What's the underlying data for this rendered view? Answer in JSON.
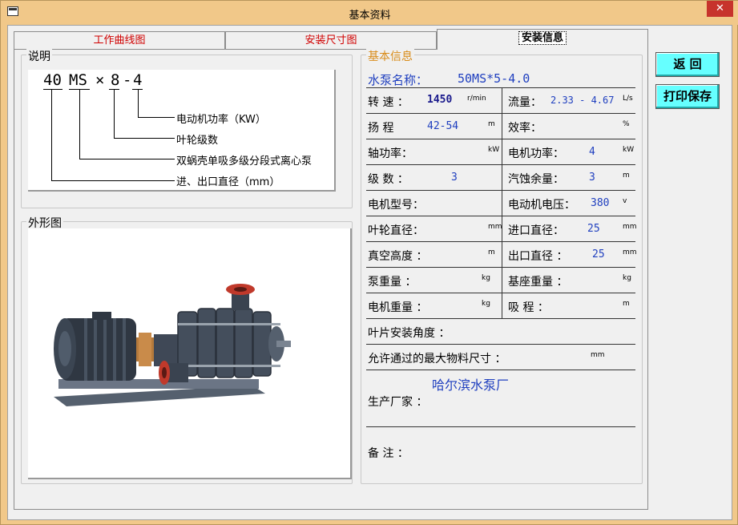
{
  "window": {
    "title": "基本资料",
    "close_label": "✕"
  },
  "tabs": [
    {
      "label": "工作曲线图"
    },
    {
      "label": "安装尺寸图"
    },
    {
      "label": "安装信息"
    }
  ],
  "buttons": {
    "back": "返  回",
    "print_save": "打印保存"
  },
  "explain": {
    "legend": "说明",
    "code_parts": [
      "40",
      "MS",
      "×",
      "8",
      "-",
      "4"
    ],
    "desc_power": "电动机功率（KW）",
    "desc_stages": "叶轮级数",
    "desc_type": "双蜗壳单吸多级分段式离心泵",
    "desc_diameter": "进、出口直径（mm）"
  },
  "appearance": {
    "legend": "外形图"
  },
  "info": {
    "legend": "基本信息",
    "pump_name_label": "水泵名称：",
    "pump_name_value": "50MS*5-4.0",
    "speed_label": "转 速 ：",
    "speed_value": "1450",
    "speed_unit": "r/min",
    "flow_label": "流量：",
    "flow_value": "2.33 - 4.67",
    "flow_unit": "L/s",
    "head_label": "扬 程",
    "head_value": "42-54",
    "head_unit": "m",
    "eff_label": "效率：",
    "eff_unit": "%",
    "shaft_power_label": "轴功率：",
    "shaft_power_unit": "kW",
    "motor_power_label": "电机功率：",
    "motor_power_value": "4",
    "motor_power_unit": "kW",
    "stages_label": "级 数 ：",
    "stages_value": "3",
    "npsh_label": "汽蚀余量：",
    "npsh_value": "3",
    "npsh_unit": "m",
    "motor_model_label": "电机型号：",
    "motor_voltage_label": "电动机电压：",
    "motor_voltage_value": "380",
    "motor_voltage_unit": "v",
    "impeller_dia_label": "叶轮直径：",
    "impeller_dia_unit": "mm",
    "inlet_dia_label": "进口直径：",
    "inlet_dia_value": "25",
    "inlet_dia_unit": "mm",
    "vacuum_label": "真空高度 ：",
    "vacuum_unit": "m",
    "outlet_dia_label": "出口直径 ：",
    "outlet_dia_value": "25",
    "outlet_dia_unit": "mm",
    "pump_weight_label": "泵重量 ：",
    "pump_weight_unit": "kg",
    "base_weight_label": "基座重量 ：",
    "base_weight_unit": "kg",
    "motor_weight_label": "电机重量 ：",
    "motor_weight_unit": "kg",
    "suction_label": "吸 程 ：",
    "suction_unit": "m",
    "blade_angle_label": "叶片安装角度 ：",
    "max_particle_label": "允许通过的最大物料尺寸 ：",
    "max_particle_unit": "mm",
    "manufacturer_value": "哈尔滨水泵厂",
    "manufacturer_label": "生产厂家 ：",
    "remarks_label": "备  注 ："
  },
  "colors": {
    "accent": "#1f3fbf",
    "tab_text": "#d00000",
    "button": "#66ffff",
    "frame": "#f1c889"
  }
}
